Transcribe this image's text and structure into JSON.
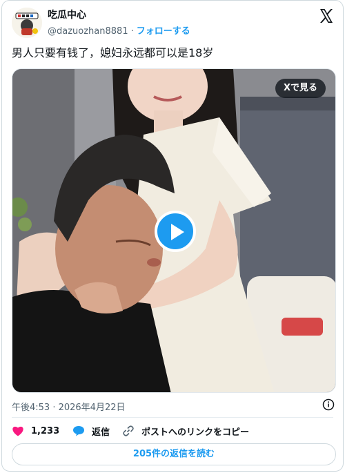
{
  "author": {
    "display_name": "吃瓜中心",
    "handle": "@dazuozhan8881",
    "separator": "·",
    "follow_label": "フォローする"
  },
  "tweet": {
    "text": "男人只要有钱了，媳妇永远都可以是18岁"
  },
  "media": {
    "view_on_x_label": "Xで見る",
    "type": "video"
  },
  "meta": {
    "timestamp": "午後4:53 · 2026年4月22日"
  },
  "actions": {
    "like_count": "1,233",
    "reply_label": "返信",
    "copy_link_label": "ポストへのリンクをコピー"
  },
  "replies_button_label": "205件の返信を読む",
  "colors": {
    "accent": "#1d9bf0",
    "like": "#f91880",
    "text_secondary": "#536471"
  },
  "icons": [
    "x-logo-icon",
    "heart-icon",
    "reply-bubble-icon",
    "link-icon",
    "info-icon",
    "play-icon"
  ]
}
